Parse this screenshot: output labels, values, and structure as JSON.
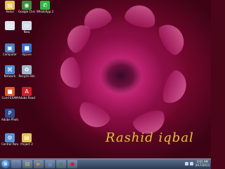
{
  "desktop": {
    "signature": "Rashid iqbal",
    "icons": [
      {
        "label": "Rahul",
        "icon": "folder-icon",
        "color": "#e5c35a"
      },
      {
        "label": "Google Chrome",
        "icon": "chrome-icon",
        "color": "#3a8f3a"
      },
      {
        "label": "WhatsApp 2012",
        "icon": "whatsapp-icon",
        "color": "#2bb741"
      },
      {
        "label": "",
        "icon": "document-icon",
        "color": "#dfe6ee"
      },
      {
        "label": "New",
        "icon": "document-icon",
        "color": "#d0dbe8"
      },
      {
        "label": "Computer",
        "icon": "computer-icon",
        "color": "#4c7fc0"
      },
      {
        "label": "ApLive",
        "icon": "app-icon",
        "color": "#3a6fd0"
      },
      {
        "label": "Network",
        "icon": "network-icon",
        "color": "#4a8ad0"
      },
      {
        "label": "Recycle Bin",
        "icon": "recycle-bin-icon",
        "color": "#9fb6cc"
      },
      {
        "label": "Cond EXAM",
        "icon": "app-icon",
        "color": "#d85a2a"
      },
      {
        "label": "Adobe Reader",
        "icon": "adobe-icon",
        "color": "#c8202a"
      },
      {
        "label": "Adobe Photoshop",
        "icon": "photoshop-icon",
        "color": "#2e4a8a"
      },
      {
        "label": "Control Panel",
        "icon": "control-panel-icon",
        "color": "#5a8fd0"
      },
      {
        "label": "Project 2",
        "icon": "folder-icon",
        "color": "#e5c35a"
      }
    ]
  },
  "taskbar": {
    "start_label": "Start",
    "pinned": [
      {
        "name": "ie-icon",
        "glyph": "e",
        "color": "#2a7fd0"
      },
      {
        "name": "folder-icon",
        "glyph": "▤",
        "color": "#e5c35a"
      },
      {
        "name": "media-player-icon",
        "glyph": "▶",
        "color": "#e08a20"
      },
      {
        "name": "app-icon",
        "glyph": "■",
        "color": "#6a8ab0"
      },
      {
        "name": "app-icon",
        "glyph": "◆",
        "color": "#3a8f3a"
      },
      {
        "name": "app-icon",
        "glyph": "●",
        "color": "#c8202a"
      }
    ],
    "clock_time": "3:01 AM",
    "clock_date": "3/17/2013"
  }
}
